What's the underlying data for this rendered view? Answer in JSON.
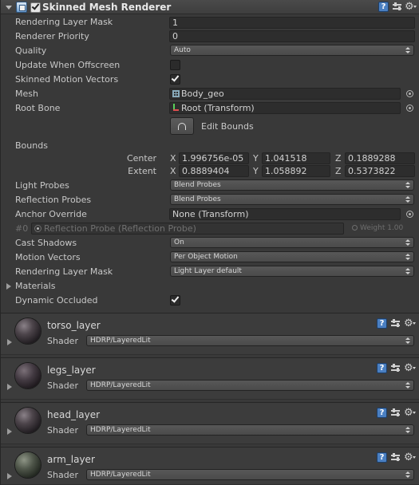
{
  "component": {
    "title": "Skinned Mesh Renderer",
    "enabled": true,
    "expanded": true,
    "icons": [
      "component-icon",
      "help-icon",
      "preset-icon",
      "gear-icon"
    ]
  },
  "properties": {
    "rendering_layer_mask_top": {
      "label": "Rendering Layer Mask",
      "value": "1"
    },
    "renderer_priority": {
      "label": "Renderer Priority",
      "value": "0"
    },
    "quality": {
      "label": "Quality",
      "value": "Auto"
    },
    "update_when_offscreen": {
      "label": "Update When Offscreen",
      "checked": false
    },
    "skinned_motion_vectors": {
      "label": "Skinned Motion Vectors",
      "checked": true
    },
    "mesh": {
      "label": "Mesh",
      "value": "Body_geo"
    },
    "root_bone": {
      "label": "Root Bone",
      "value": "Root (Transform)"
    },
    "edit_bounds": {
      "label": "Edit Bounds"
    },
    "bounds": {
      "label": "Bounds",
      "center": {
        "label": "Center",
        "x": "1.996756e-05",
        "y": "1.041518",
        "z": "0.1889288"
      },
      "extent": {
        "label": "Extent",
        "x": "0.8889404",
        "y": "1.058892",
        "z": "0.5373822"
      },
      "axis_x": "X",
      "axis_y": "Y",
      "axis_z": "Z"
    },
    "light_probes": {
      "label": "Light Probes",
      "value": "Blend Probes"
    },
    "reflection_probes": {
      "label": "Reflection Probes",
      "value": "Blend Probes"
    },
    "anchor_override": {
      "label": "Anchor Override",
      "value": "None (Transform)"
    },
    "probe_entry": {
      "index": "#0",
      "value": "Reflection Probe (Reflection Probe)",
      "weight": "Weight 1.00"
    },
    "cast_shadows": {
      "label": "Cast Shadows",
      "value": "On"
    },
    "motion_vectors": {
      "label": "Motion Vectors",
      "value": "Per Object Motion"
    },
    "rendering_layer_mask": {
      "label": "Rendering Layer Mask",
      "value": "Light Layer default"
    },
    "materials": {
      "label": "Materials",
      "expanded": false
    },
    "dynamic_occluded": {
      "label": "Dynamic Occluded",
      "checked": true
    }
  },
  "materials": [
    {
      "name": "torso_layer",
      "shader_label": "Shader",
      "shader": "HDRP/LayeredLit"
    },
    {
      "name": "legs_layer",
      "shader_label": "Shader",
      "shader": "HDRP/LayeredLit"
    },
    {
      "name": "head_layer",
      "shader_label": "Shader",
      "shader": "HDRP/LayeredLit"
    },
    {
      "name": "arm_layer",
      "shader_label": "Shader",
      "shader": "HDRP/LayeredLit"
    }
  ]
}
